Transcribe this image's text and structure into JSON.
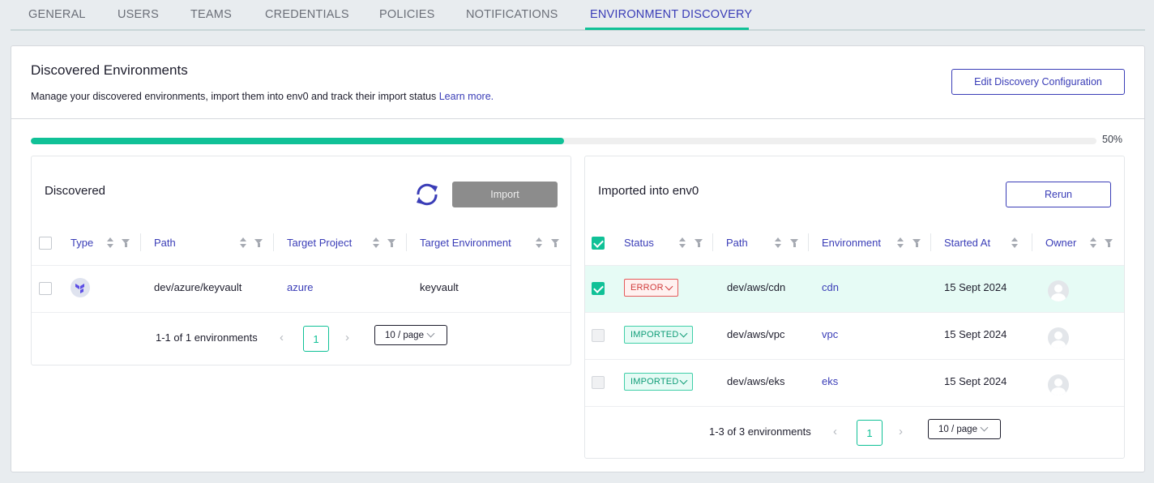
{
  "tabs": [
    "GENERAL",
    "USERS",
    "TEAMS",
    "CREDENTIALS",
    "POLICIES",
    "NOTIFICATIONS",
    "ENVIRONMENT DISCOVERY"
  ],
  "active_tab": "ENVIRONMENT DISCOVERY",
  "header": {
    "title": "Discovered Environments",
    "description": "Manage your discovered environments, import them into env0 and track their import status",
    "learn_more": "Learn more.",
    "edit_button": "Edit Discovery Configuration"
  },
  "progress": {
    "percent_value": 50,
    "label": "50%"
  },
  "colors": {
    "accent": "#3a3db7",
    "success": "#10c197",
    "error": "#d13d3d"
  },
  "discovered": {
    "title": "Discovered",
    "refresh_icon": "refresh-icon",
    "import_label": "Import",
    "columns": [
      "Type",
      "Path",
      "Target Project",
      "Target Environment"
    ],
    "rows": [
      {
        "type_icon": "terraform-icon",
        "path": "dev/azure/keyvault",
        "target_project": "azure",
        "target_environment": "keyvault"
      }
    ],
    "pagination": {
      "summary": "1-1 of 1 environments",
      "page": "1",
      "page_size": "10 / page"
    }
  },
  "imported": {
    "title": "Imported into env0",
    "rerun_label": "Rerun",
    "columns": [
      "Status",
      "Path",
      "Environment",
      "Started At",
      "Owner"
    ],
    "rows": [
      {
        "status": "ERROR",
        "path": "dev/aws/cdn",
        "environment": "cdn",
        "started_at": "15 Sept 2024",
        "selected": true
      },
      {
        "status": "IMPORTED",
        "path": "dev/aws/vpc",
        "environment": "vpc",
        "started_at": "15 Sept 2024",
        "selected": false
      },
      {
        "status": "IMPORTED",
        "path": "dev/aws/eks",
        "environment": "eks",
        "started_at": "15 Sept 2024",
        "selected": false
      }
    ],
    "pagination": {
      "summary": "1-3 of 3 environments",
      "page": "1",
      "page_size": "10 / page"
    }
  }
}
